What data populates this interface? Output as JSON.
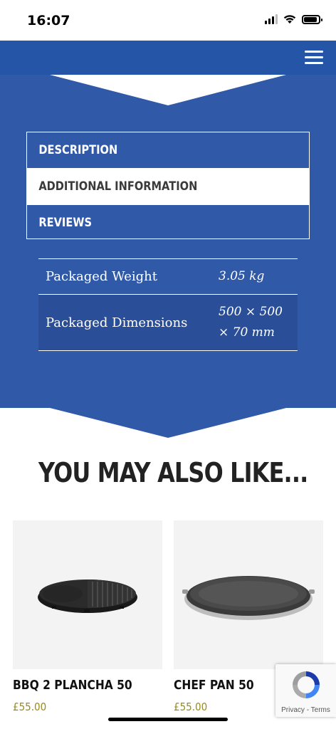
{
  "status_bar": {
    "time": "16:07"
  },
  "colors": {
    "brand_blue": "#3059a8",
    "header_blue": "#2555a6",
    "price_gold": "#9a8a1c"
  },
  "header": {
    "menu_icon": "hamburger-menu-icon"
  },
  "tabs": [
    {
      "label": "DESCRIPTION",
      "active": false
    },
    {
      "label": "ADDITIONAL INFORMATION",
      "active": true
    },
    {
      "label": "REVIEWS",
      "active": false
    }
  ],
  "additional_info": [
    {
      "label": "Packaged Weight",
      "value": "3.05 kg"
    },
    {
      "label": "Packaged Dimensions",
      "value": "500 × 500 × 70 mm"
    }
  ],
  "related": {
    "title": "YOU MAY ALSO LIKE...",
    "products": [
      {
        "name": "BBQ 2 PLANCHA 50",
        "price": "£55.00"
      },
      {
        "name": "CHEF PAN 50",
        "price": "£55.00"
      }
    ]
  },
  "recaptcha": {
    "links": "Privacy - Terms"
  }
}
